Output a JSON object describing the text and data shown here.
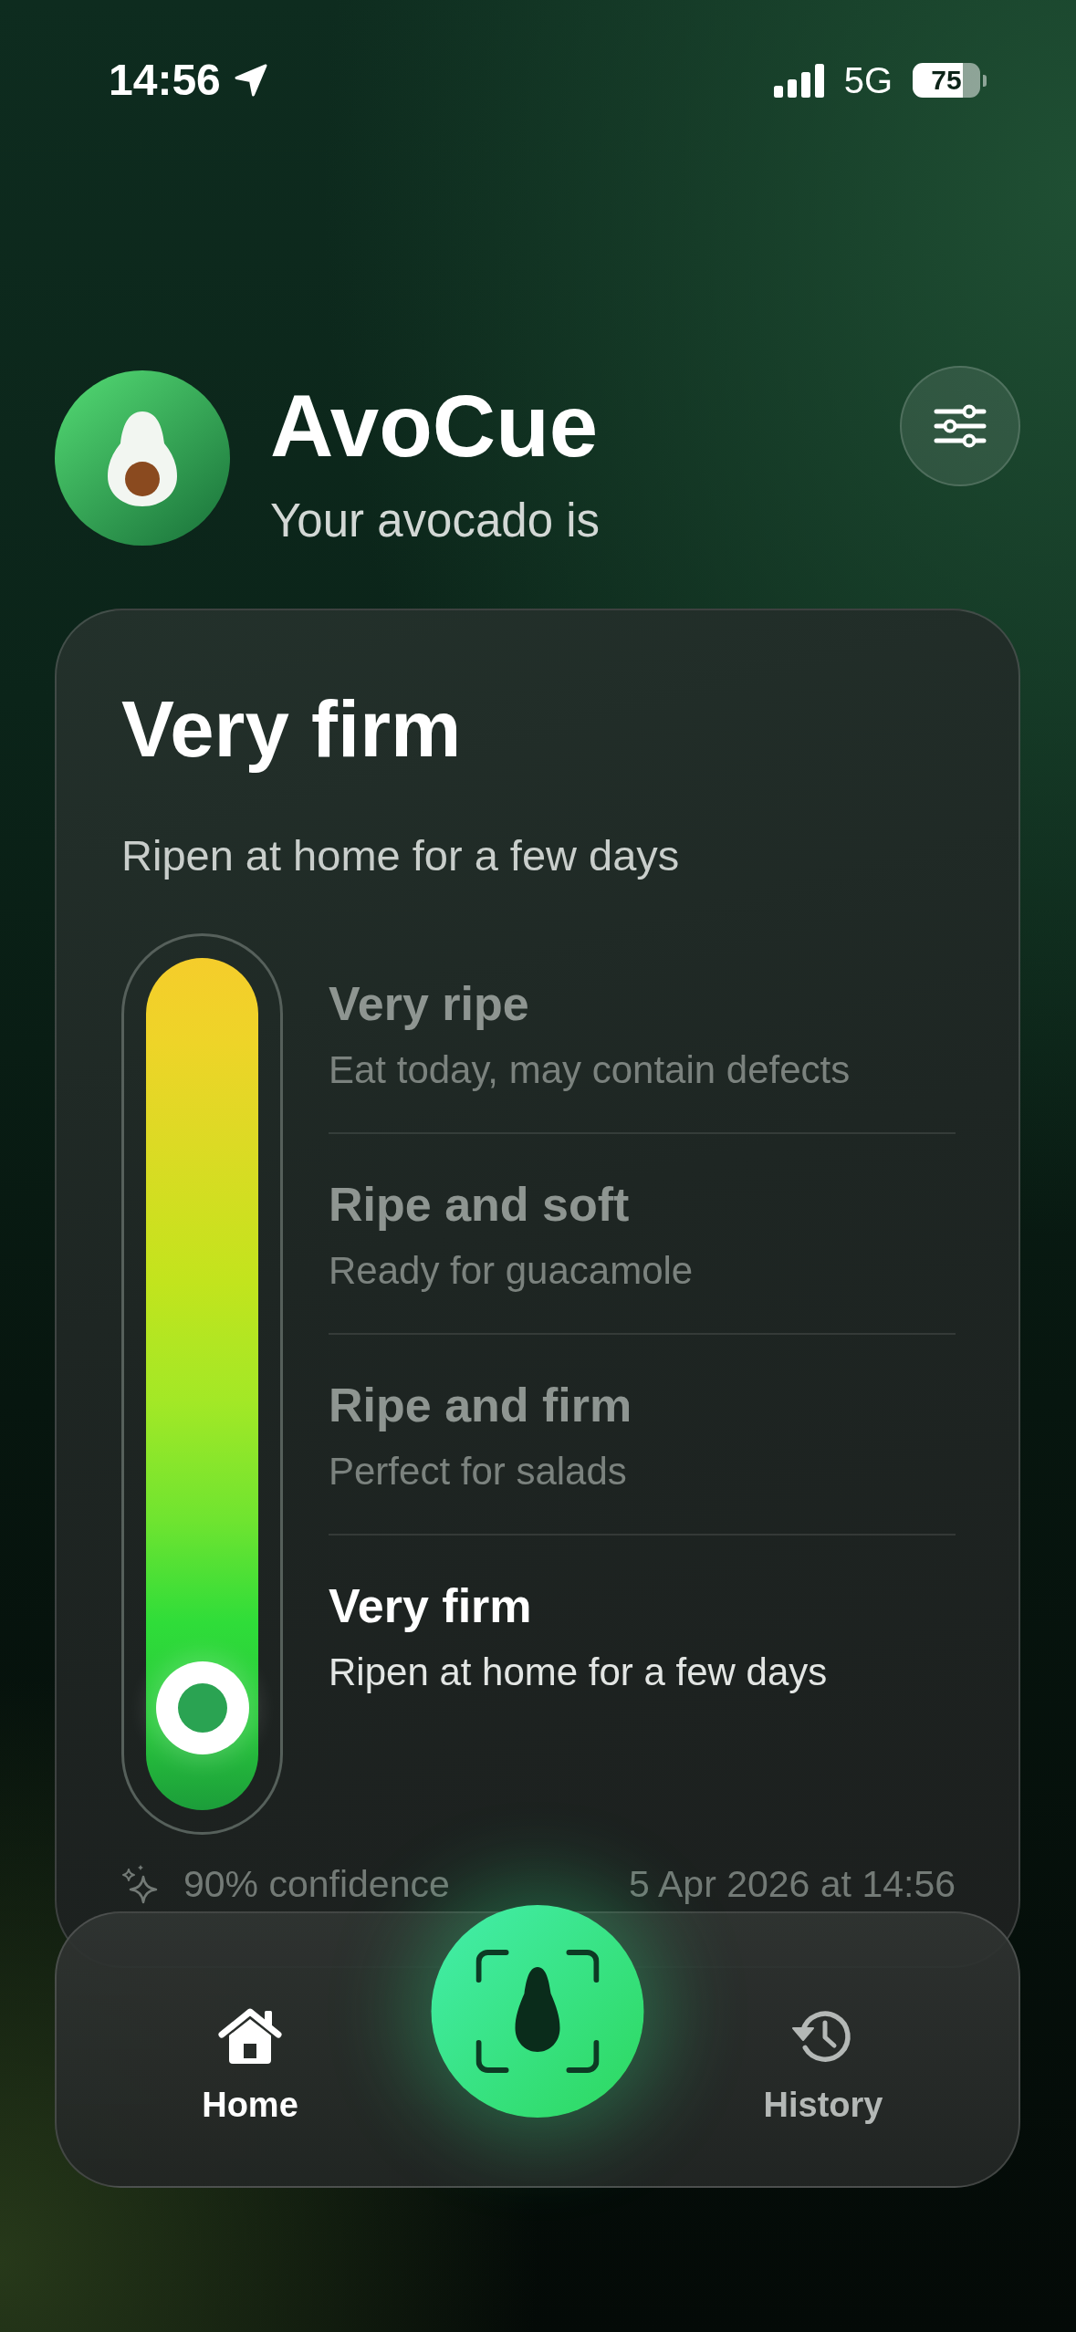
{
  "status_bar": {
    "time": "14:56",
    "network": "5G",
    "battery": "75"
  },
  "header": {
    "title": "AvoCue",
    "subtitle": "Your avocado is"
  },
  "result_card": {
    "title": "Very firm",
    "description": "Ripen at home for a few days",
    "stages": [
      {
        "title": "Very ripe",
        "description": "Eat today, may contain defects",
        "selected": false
      },
      {
        "title": "Ripe and soft",
        "description": "Ready for guacamole",
        "selected": false
      },
      {
        "title": "Ripe and firm",
        "description": "Perfect for salads",
        "selected": false
      },
      {
        "title": "Very firm",
        "description": "Ripen at home for a few days",
        "selected": true
      }
    ],
    "confidence": "90% confidence",
    "timestamp": "5 Apr 2026 at 14:56"
  },
  "tab_bar": {
    "tabs": [
      {
        "label": "Home",
        "selected": true
      },
      {
        "label": "History",
        "selected": false
      }
    ]
  }
}
